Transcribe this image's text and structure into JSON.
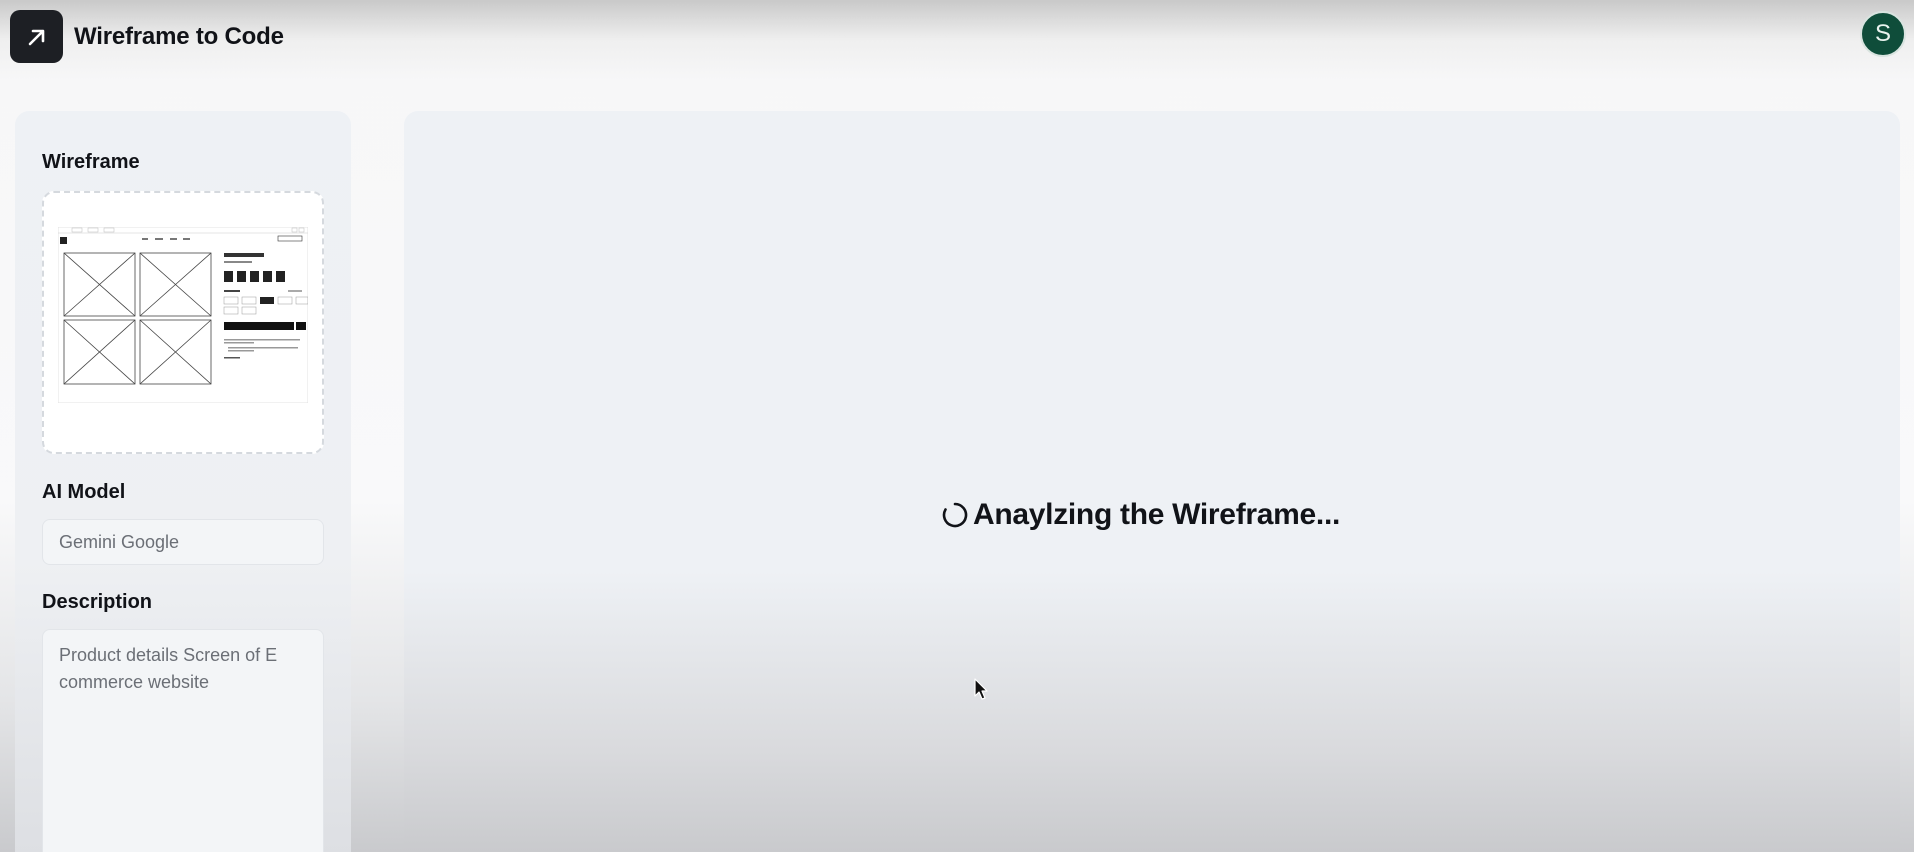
{
  "header": {
    "app_title": "Wireframe to Code",
    "logo_icon": "arrow-up-right-icon",
    "avatar_initial": "S",
    "avatar_color": "#0f4d3a"
  },
  "left_panel": {
    "wireframe_label": "Wireframe",
    "model_label": "AI Model",
    "model_value": "Gemini Google",
    "description_label": "Description",
    "description_value": "Product details Screen of E\ncommerce website"
  },
  "main": {
    "status_text": "Anaylzing the Wireframe...",
    "status_icon": "loading-spinner-icon"
  },
  "colors": {
    "logo_bg": "#1d1f24",
    "text": "#111318",
    "panel_bg": "#eef1f5"
  }
}
